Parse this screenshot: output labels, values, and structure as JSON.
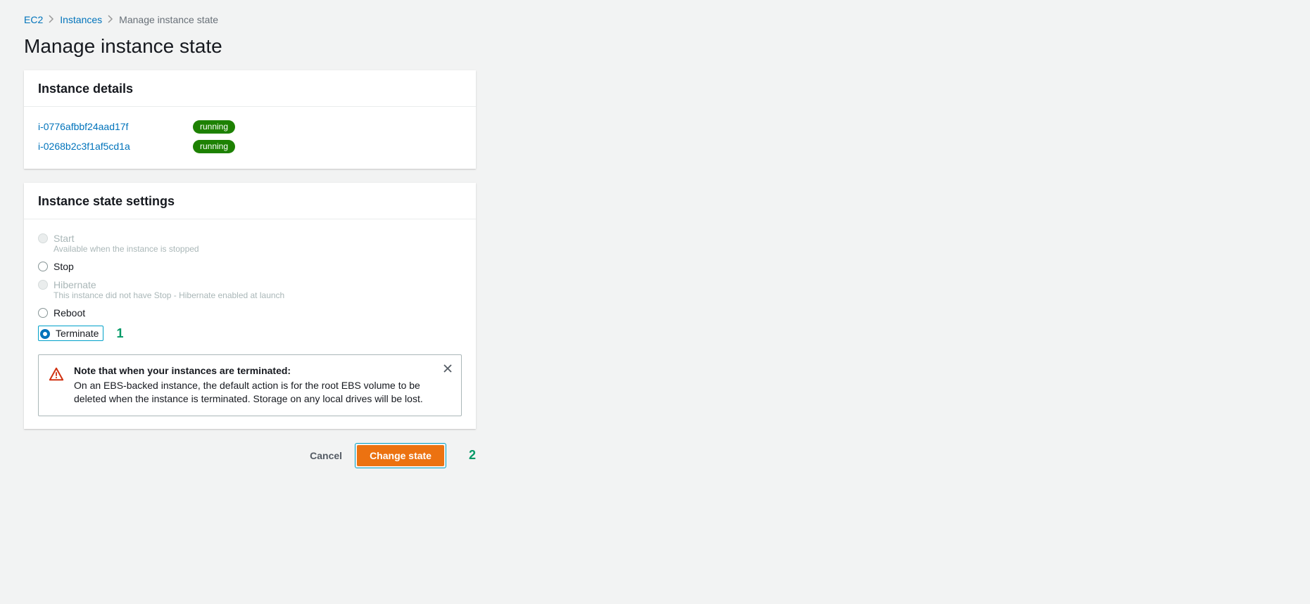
{
  "breadcrumb": {
    "root": "EC2",
    "parent": "Instances",
    "current": "Manage instance state"
  },
  "title": "Manage instance state",
  "details": {
    "heading": "Instance details",
    "instances": [
      {
        "id": "i-0776afbbf24aad17f",
        "state": "running"
      },
      {
        "id": "i-0268b2c3f1af5cd1a",
        "state": "running"
      }
    ]
  },
  "settings": {
    "heading": "Instance state settings",
    "options": {
      "start": {
        "label": "Start",
        "sub": "Available when the instance is stopped"
      },
      "stop": {
        "label": "Stop"
      },
      "hibernate": {
        "label": "Hibernate",
        "sub": "This instance did not have Stop - Hibernate enabled at launch"
      },
      "reboot": {
        "label": "Reboot"
      },
      "terminate": {
        "label": "Terminate"
      }
    },
    "selected": "terminate"
  },
  "warning": {
    "title": "Note that when your instances are terminated:",
    "body": "On an EBS-backed instance, the default action is for the root EBS volume to be deleted when the instance is terminated. Storage on any local drives will be lost."
  },
  "buttons": {
    "cancel": "Cancel",
    "change": "Change state"
  },
  "annotations": {
    "one": "1",
    "two": "2"
  }
}
